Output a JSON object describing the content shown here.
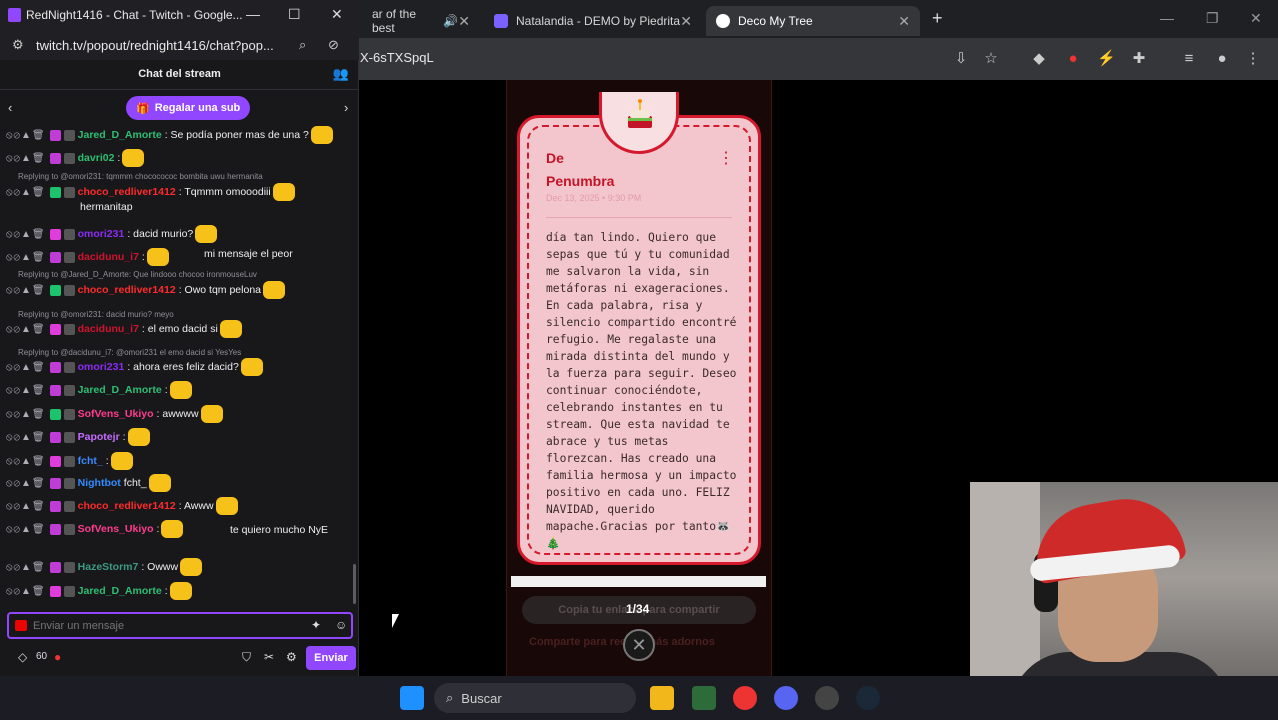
{
  "chrome": {
    "tabs": [
      {
        "label": "ar of the best",
        "icon": "sound-icon"
      },
      {
        "label": "Natalandia - DEMO by Piedrita",
        "icon": "gmail-icon"
      },
      {
        "label": "Deco My Tree",
        "icon": "deco-icon"
      }
    ],
    "url": "X-6sTXSpqL"
  },
  "twitch": {
    "window_title": "RedNight1416 - Chat - Twitch - Google...",
    "url": "twitch.tv/popout/rednight1416/chat?pop...",
    "header": "Chat del stream",
    "gift_sub": "Regalar una sub",
    "messages": [
      {
        "type": "msg",
        "user": "Jared_D_Amorte",
        "color": "#2dbf73",
        "text": ": Se podía poner mas de una ?"
      },
      {
        "type": "msg",
        "user": "davri02",
        "color": "#2dbf73",
        "text": ":"
      },
      {
        "type": "reply",
        "text": "Replying to @omori231: tqmmm chococococ bombita uwu hermanita"
      },
      {
        "type": "msg",
        "user": "choco_redliver1412",
        "color": "#ff2a2a",
        "text": ": Tqmmm omooodiii"
      },
      {
        "type": "cont",
        "text": "hermanitap"
      },
      {
        "type": "msg",
        "user": "omori231",
        "color": "#8b2cf0",
        "text": ": dacid murio?"
      },
      {
        "type": "msg",
        "user": "dacidunu_i7",
        "color": "#d1132d",
        "text": ":"
      },
      {
        "type": "cont2",
        "text": "mi mensaje el peor"
      },
      {
        "type": "reply",
        "text": "Replying to @Jared_D_Amorte: Que lindooo chocoo ironmouseLuv"
      },
      {
        "type": "msg",
        "user": "choco_redliver1412",
        "color": "#ff2a2a",
        "text": ": Owo tqm pelona"
      },
      {
        "type": "reply",
        "text": "Replying to @omori231: dacid murio? meyo"
      },
      {
        "type": "msg",
        "user": "dacidunu_i7",
        "color": "#d1132d",
        "text": ": el emo dacid si"
      },
      {
        "type": "reply",
        "text": "Replying to @dacidunu_i7: @omori231 el emo dacid si YesYes"
      },
      {
        "type": "msg",
        "user": "omori231",
        "color": "#8b2cf0",
        "text": ": ahora eres feliz dacid?"
      },
      {
        "type": "msg",
        "user": "Jared_D_Amorte",
        "color": "#2dbf73",
        "text": ":"
      },
      {
        "type": "msg",
        "user": "SofVens_Ukiyo",
        "color": "#ff3c8e",
        "text": ": awwww"
      },
      {
        "type": "msg",
        "user": "Papotejr",
        "color": "#c66cff",
        "text": ":"
      },
      {
        "type": "msg",
        "user": "fcht_",
        "color": "#3a8cff",
        "text": ":"
      },
      {
        "type": "msg",
        "user": "Nightbot",
        "color": "#2f8bff",
        "text": "fcht_"
      },
      {
        "type": "msg",
        "user": "choco_redliver1412",
        "color": "#ff2a2a",
        "text": ": Awww"
      },
      {
        "type": "msg",
        "user": "SofVens_Ukiyo",
        "color": "#ff3c8e",
        "text": ":"
      },
      {
        "type": "cont3",
        "text": "te quiero mucho NyE"
      },
      {
        "type": "msg",
        "user": "HazeStorm7",
        "color": "#3e9a82",
        "text": ": Owww"
      },
      {
        "type": "msg",
        "user": "Jared_D_Amorte",
        "color": "#2dbf73",
        "text": ":"
      }
    ],
    "input_placeholder": "Enviar un mensaje",
    "points": "60",
    "send_label": "Enviar"
  },
  "deco": {
    "from_label": "De",
    "author": "Penumbra",
    "date": "Dec 13, 2025 • 9:30 PM",
    "letter": "día tan lindo. Quiero que sepas que tú y tu comunidad me salvaron la vida, sin metáforas ni exageraciones. En cada palabra, risa y silencio compartido encontré refugio. Me regalaste una mirada distinta del mundo y la fuerza para seguir. Deseo continuar conociéndote, celebrando instantes en tu stream. Que esta navidad te abrace y tus metas florezcan. Has creado una familia hermosa y un impacto positivo en cada uno. FELIZ NAVIDAD, querido mapache.Gracias por tanto🦝 🎄",
    "page": "1/34",
    "share_label": "Copia tu enlace para compartir",
    "share2_label": "Comparte para recibir más adornos"
  },
  "taskbar": {
    "search_label": "Buscar"
  }
}
